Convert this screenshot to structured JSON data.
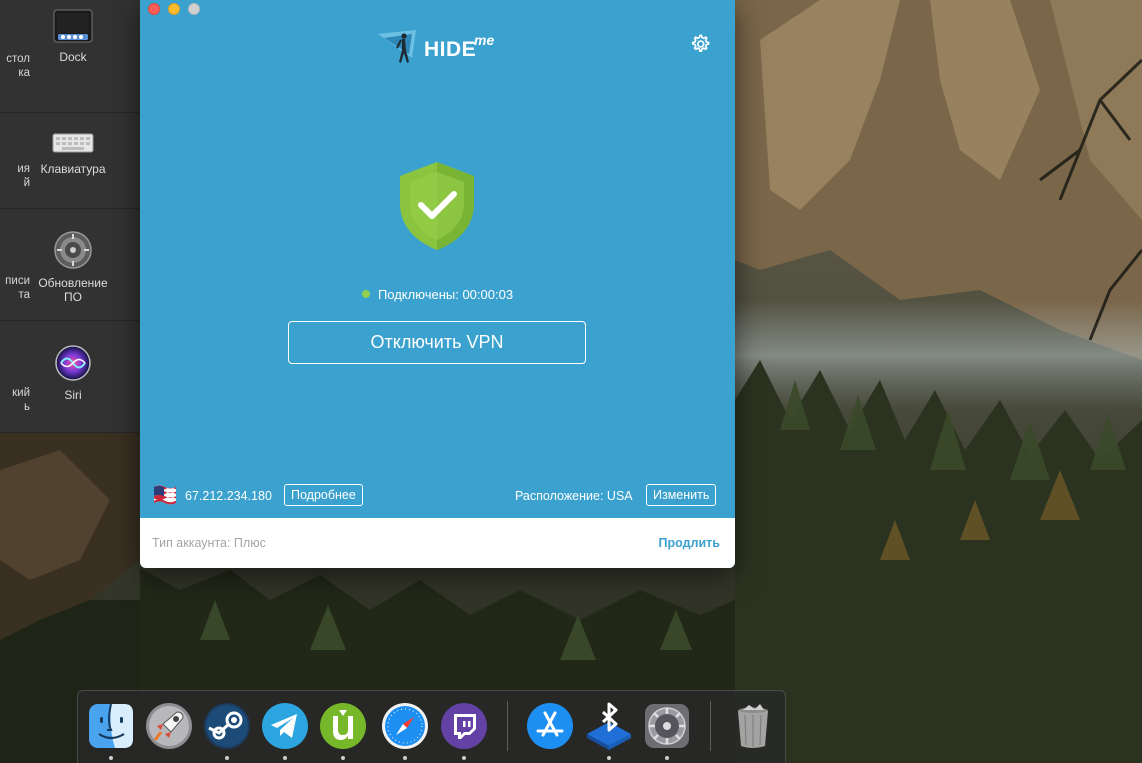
{
  "system_prefs": {
    "rows": [
      {
        "cut_label": "стол\nка",
        "tile_label": "Dock",
        "icon": "dock-icon"
      },
      {
        "cut_label": "ия\nй",
        "tile_label": "Клавиатура",
        "icon": "keyboard-icon"
      },
      {
        "cut_label": "писи\nта",
        "tile_label": "Обновление\nПО",
        "icon": "software-update-icon"
      },
      {
        "cut_label": "кий\nь",
        "tile_label": "Siri",
        "icon": "siri-icon"
      }
    ]
  },
  "app": {
    "logo_text": "HIDE",
    "logo_suffix": "me",
    "status_text": "Подключены: 00:00:03",
    "disconnect_label": "Отключить VPN",
    "ip_address": "67.212.234.180",
    "more_label": "Подробнее",
    "location_text": "Расположение: USA",
    "change_label": "Изменить",
    "account_text": "Тип аккаунта: Плюс",
    "renew_label": "Продлить",
    "colors": {
      "window_bg": "#3ba1cf",
      "shield_green": "#8bc540",
      "status_dot": "#8fd14f",
      "renew_link": "#3ba1cf"
    }
  },
  "dock": {
    "apps": [
      {
        "name": "Finder",
        "icon": "finder-icon",
        "running": true
      },
      {
        "name": "Launchpad",
        "icon": "launchpad-icon",
        "running": false
      },
      {
        "name": "Steam",
        "icon": "steam-icon",
        "running": true
      },
      {
        "name": "Telegram",
        "icon": "telegram-icon",
        "running": true
      },
      {
        "name": "uTorrent",
        "icon": "utorrent-icon",
        "running": true
      },
      {
        "name": "Safari",
        "icon": "safari-icon",
        "running": true
      },
      {
        "name": "Twitch",
        "icon": "twitch-icon",
        "running": true
      },
      {
        "name": "App Store",
        "icon": "app-store-icon",
        "running": false
      },
      {
        "name": "Bluetooth File Exchange",
        "icon": "bluetooth-icon",
        "running": true
      },
      {
        "name": "System Preferences",
        "icon": "system-preferences-icon",
        "running": true
      },
      {
        "name": "Trash",
        "icon": "trash-icon",
        "running": false
      }
    ]
  }
}
